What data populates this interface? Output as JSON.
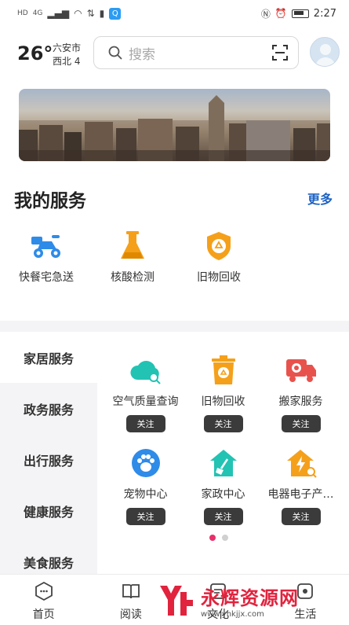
{
  "status_bar": {
    "left_labels": [
      "HD",
      "4G"
    ],
    "time": "2:27",
    "icons": [
      "signal-icon",
      "wifi-icon",
      "data-icon",
      "battery-saver-icon",
      "app-q-icon",
      "nfc-icon",
      "alarm-icon",
      "battery-icon"
    ]
  },
  "weather": {
    "temp": "26°",
    "city": "六安市",
    "wind": "西北 4"
  },
  "search": {
    "placeholder": "搜索"
  },
  "my_services": {
    "title": "我的服务",
    "more": "更多",
    "items": [
      {
        "label": "快餐宅急送",
        "icon": "delivery-scooter-icon"
      },
      {
        "label": "核酸检测",
        "icon": "flask-icon"
      },
      {
        "label": "旧物回收",
        "icon": "recycle-badge-icon"
      }
    ]
  },
  "categories": [
    "家居服务",
    "政务服务",
    "出行服务",
    "健康服务",
    "美食服务"
  ],
  "active_category": "家居服务",
  "services_grid": [
    {
      "label": "空气质量查询",
      "icon": "cloud-search-icon",
      "button": "关注"
    },
    {
      "label": "旧物回收",
      "icon": "recycle-bin-icon",
      "button": "关注"
    },
    {
      "label": "搬家服务",
      "icon": "moving-truck-icon",
      "button": "关注"
    },
    {
      "label": "宠物中心",
      "icon": "paw-icon",
      "button": "关注"
    },
    {
      "label": "家政中心",
      "icon": "house-broom-icon",
      "button": "关注"
    },
    {
      "label": "电器电子产…",
      "icon": "house-lightning-icon",
      "button": "关注"
    }
  ],
  "pager": {
    "pages": 2,
    "current": 1
  },
  "tabs": [
    {
      "label": "首页",
      "icon": "home-hex-icon"
    },
    {
      "label": "阅读",
      "icon": "book-icon"
    },
    {
      "label": "文化",
      "icon": "culture-icon"
    },
    {
      "label": "生活",
      "icon": "life-icon"
    }
  ],
  "watermark": {
    "name": "永辉资源网",
    "url": "www.yhkjjx.com"
  },
  "colors": {
    "accent": "#1d63c4",
    "brand_orange": "#f5a01a",
    "teal": "#22c3b3",
    "blue": "#2f8be8",
    "red": "#e8524d",
    "pager_active": "#e8306b"
  }
}
